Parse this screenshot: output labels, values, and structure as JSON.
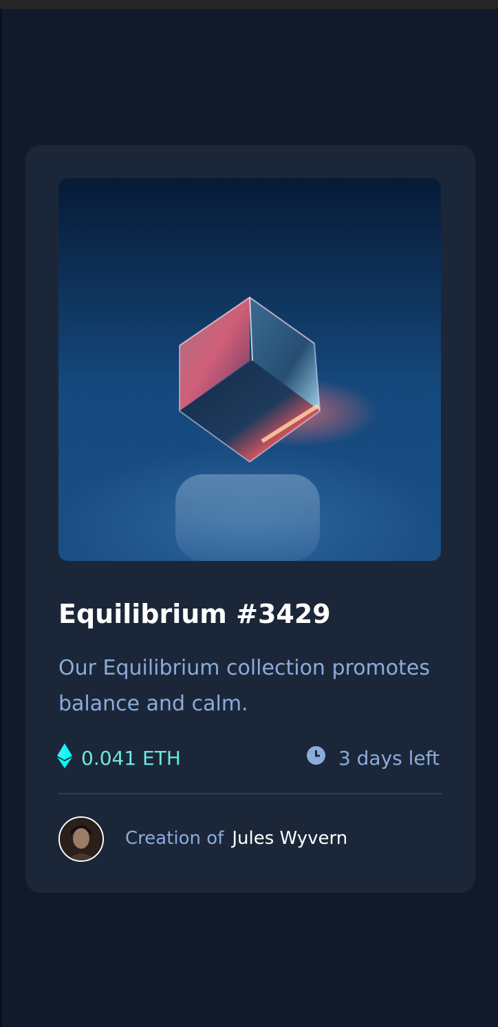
{
  "card": {
    "image_alt": "Equilibrium crystal cube",
    "title": "Equilibrium #3429",
    "description": "Our Equilibrium collection promotes balance and calm.",
    "price": "0.041 ETH",
    "time_left": "3 days left",
    "creator_prefix": "Creation of",
    "creator_name": "Jules Wyvern"
  },
  "icons": {
    "price": "ethereum-icon",
    "time": "clock-icon"
  },
  "colors": {
    "page_bg": "#111a2b",
    "card_bg": "#1b2739",
    "accent_cyan": "#00fff8",
    "soft_blue": "#8bacda",
    "white": "#ffffff"
  }
}
